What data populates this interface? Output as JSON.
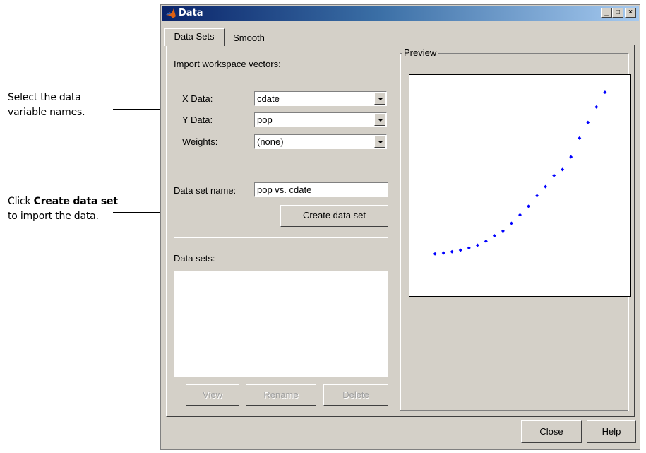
{
  "annotations": {
    "select_text_line1": "Select the data",
    "select_text_line2": "variable names.",
    "click_prefix": "Click ",
    "click_bold": "Create data set",
    "click_line2": "to import the data."
  },
  "window": {
    "title": "Data",
    "controls": {
      "minimize": "_",
      "maximize": "□",
      "close": "×"
    }
  },
  "tabs": [
    {
      "label": "Data Sets",
      "active": true
    },
    {
      "label": "Smooth",
      "active": false
    }
  ],
  "import_section": {
    "heading": "Import workspace vectors:",
    "x_label": "X Data:",
    "x_value": "cdate",
    "y_label": "Y Data:",
    "y_value": "pop",
    "w_label": "Weights:",
    "w_value": "(none)"
  },
  "dataset_name": {
    "label": "Data set name:",
    "value": "pop vs. cdate"
  },
  "buttons": {
    "create": "Create data set",
    "view": "View",
    "rename": "Rename",
    "delete": "Delete",
    "close": "Close",
    "help": "Help"
  },
  "datasets_label": "Data sets:",
  "preview": {
    "title": "Preview",
    "marker_color": "#0000ff"
  },
  "chart_data": {
    "type": "scatter",
    "x": [
      1790,
      1800,
      1810,
      1820,
      1830,
      1840,
      1850,
      1860,
      1870,
      1880,
      1890,
      1900,
      1910,
      1920,
      1930,
      1940,
      1950,
      1960,
      1970,
      1980,
      1990
    ],
    "y": [
      3.9,
      5.3,
      7.2,
      9.6,
      12.9,
      17.1,
      23.1,
      31.4,
      38.6,
      50.2,
      62.9,
      76.0,
      92.0,
      105.7,
      122.8,
      131.7,
      150.7,
      179.3,
      203.2,
      226.5,
      248.7
    ],
    "xlim": [
      1760,
      2020
    ],
    "ylim": [
      -60,
      275
    ],
    "color": "#0000ff"
  }
}
